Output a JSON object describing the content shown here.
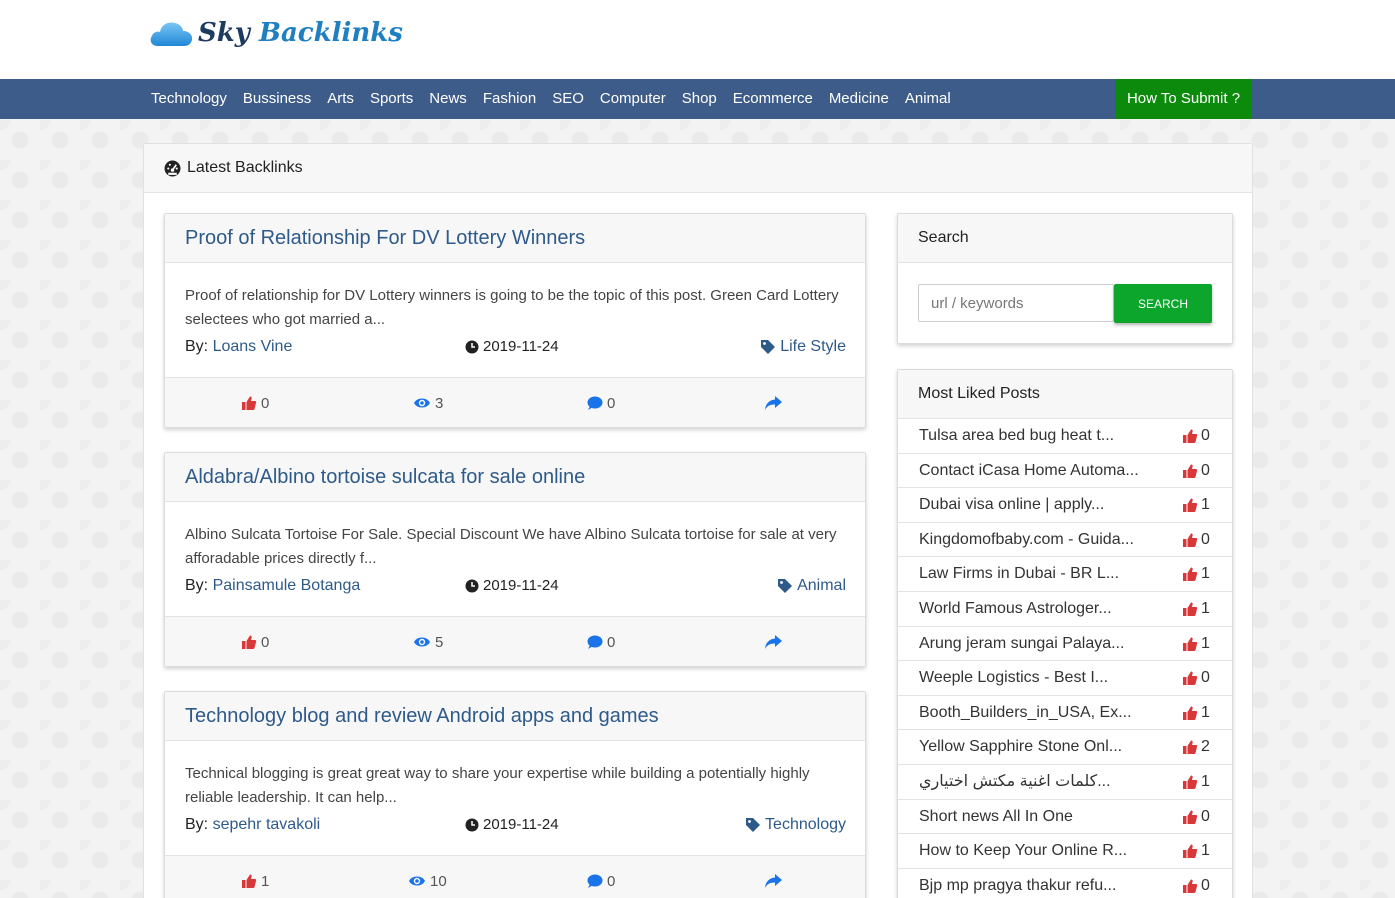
{
  "site": {
    "name_part1": "Sky",
    "name_part2": "Backlinks"
  },
  "nav": {
    "items": [
      "Technology",
      "Bussiness",
      "Arts",
      "Sports",
      "News",
      "Fashion",
      "SEO",
      "Computer",
      "Shop",
      "Ecommerce",
      "Medicine",
      "Animal"
    ],
    "submit_label": "How To Submit ?"
  },
  "main": {
    "heading": "Latest Backlinks",
    "posts": [
      {
        "title": "Proof of Relationship For DV Lottery Winners",
        "description": "Proof of relationship for DV Lottery winners is going to be the topic of this post. Green Card Lottery selectees who got married a...",
        "by_label": "By:",
        "author": "Loans Vine",
        "date": "2019-11-24",
        "category": "Life Style",
        "likes": "0",
        "views": "3",
        "comments": "0"
      },
      {
        "title": "Aldabra/Albino tortoise sulcata for sale online",
        "description": "Albino Sulcata Tortoise For Sale. Special Discount We have Albino Sulcata tortoise for sale at very afforadable prices directly f...",
        "by_label": "By:",
        "author": "Painsamule Botanga",
        "date": "2019-11-24",
        "category": "Animal",
        "likes": "0",
        "views": "5",
        "comments": "0"
      },
      {
        "title": "Technology blog and review Android apps and games",
        "description": "Technical blogging is great great way to share your expertise while building a potentially highly reliable leadership. It can help...",
        "by_label": "By:",
        "author": "sepehr tavakoli",
        "date": "2019-11-24",
        "category": "Technology",
        "likes": "1",
        "views": "10",
        "comments": "0"
      }
    ]
  },
  "sidebar": {
    "search": {
      "heading": "Search",
      "placeholder": "url / keywords",
      "button_label": "SEARCH"
    },
    "liked": {
      "heading": "Most Liked Posts",
      "items": [
        {
          "title": "Tulsa area bed bug heat t...",
          "likes": "0"
        },
        {
          "title": "Contact iCasa Home Automa...",
          "likes": "0"
        },
        {
          "title": "Dubai visa online | apply...",
          "likes": "1"
        },
        {
          "title": "Kingdomofbaby.com - Guida...",
          "likes": "0"
        },
        {
          "title": "Law Firms in Dubai - BR L...",
          "likes": "1"
        },
        {
          "title": "World Famous Astrologer...",
          "likes": "1"
        },
        {
          "title": "Arung jeram sungai Palaya...",
          "likes": "1"
        },
        {
          "title": "Weeple Logistics - Best I...",
          "likes": "0"
        },
        {
          "title": "Booth_Builders_in_USA, Ex...",
          "likes": "1"
        },
        {
          "title": "Yellow Sapphire Stone Onl...",
          "likes": "2"
        },
        {
          "title": "كلمات اغنية مكتش اختياري...",
          "likes": "1"
        },
        {
          "title": "Short news All In One",
          "likes": "0"
        },
        {
          "title": "How to Keep Your Online R...",
          "likes": "1"
        },
        {
          "title": "Bjp mp pragya thakur refu...",
          "likes": "0"
        }
      ]
    }
  },
  "colors": {
    "nav_bg": "#3e5c8a",
    "submit_bg": "#0b8a0b",
    "link": "#2e5a8a",
    "like_icon": "#d9383a",
    "view_icon": "#1a73e8",
    "search_btn": "#0da62c"
  }
}
